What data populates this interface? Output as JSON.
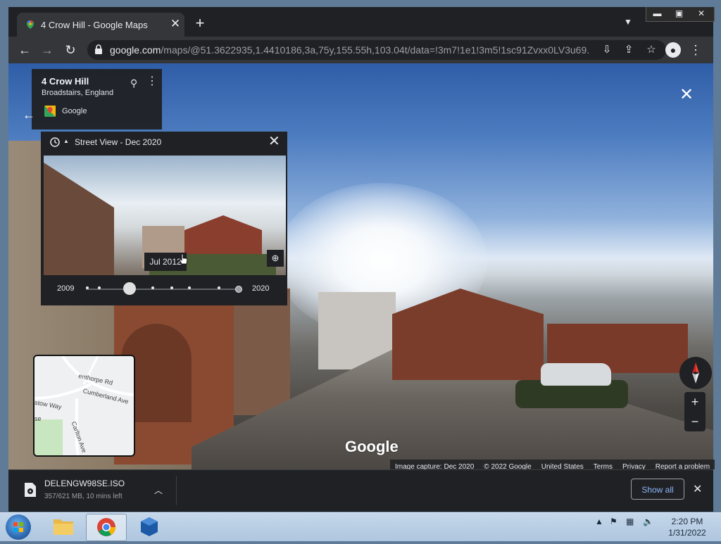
{
  "browser": {
    "tab_title": "4 Crow Hill - Google Maps",
    "url_host": "google.com",
    "url_path": "/maps/@51.3622935,1.4410186,3a,75y,155.55h,103.04t/data=!3m7!1e1!3m5!1sc91Zvxx0LV3u69..."
  },
  "place_card": {
    "name": "4 Crow Hill",
    "locality": "Broadstairs, England",
    "source": "Google"
  },
  "time_travel": {
    "title": "Street View - Dec 2020",
    "tooltip": "Jul 2012",
    "year_start": "2009",
    "year_end": "2020"
  },
  "minimap": {
    "labels": [
      "enthorpe Rd",
      "Cumberland Ave",
      "stow Way",
      "Carlton Ave",
      "se"
    ]
  },
  "viewer": {
    "watermark": "Google"
  },
  "credits": {
    "image_capture": "Image capture: Dec 2020",
    "copyright": "© 2022 Google",
    "country": "United States",
    "terms": "Terms",
    "privacy": "Privacy",
    "report": "Report a problem"
  },
  "downloads": {
    "file_name": "DELENGW98SE.ISO",
    "file_status": "357/621 MB, 10 mins left",
    "show_all": "Show all"
  },
  "taskbar": {
    "time": "2:20 PM",
    "date": "1/31/2022"
  },
  "colors": {
    "chrome_dark": "#202124",
    "chrome_toolbar": "#35363a",
    "link_blue": "#8ab4f8"
  }
}
